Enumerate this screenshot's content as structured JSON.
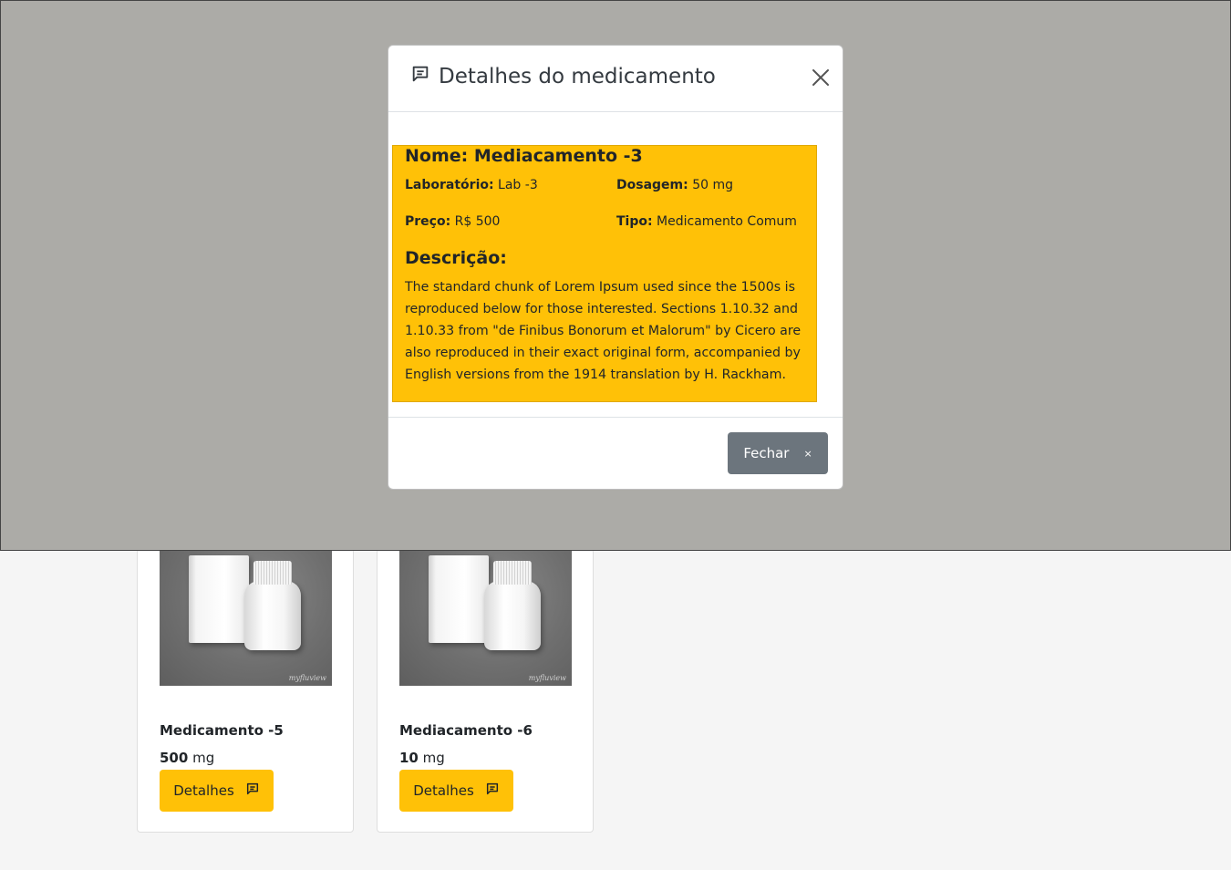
{
  "colors": {
    "warning": "#ffc107",
    "secondary": "#6c757d",
    "backdrop": "#acaba7"
  },
  "cards": [
    {
      "name": "Medicamento -5",
      "dose_value": "500",
      "dose_unit": "mg",
      "button_label": "Detalhes",
      "button_icon": "message-square-icon",
      "image_watermark": "myfluview"
    },
    {
      "name": "Mediacamento -6",
      "dose_value": "10",
      "dose_unit": "mg",
      "button_label": "Detalhes",
      "button_icon": "message-square-icon",
      "image_watermark": "myfluview"
    }
  ],
  "modal": {
    "title": "Detalhes do medicamento",
    "title_icon": "message-square-icon",
    "close_icon": "close-icon",
    "name_label": "Nome:",
    "name_value": "Mediacamento -3",
    "lab_label": "Laboratório:",
    "lab_value": "Lab -3",
    "dose_label": "Dosagem:",
    "dose_value": "50 mg",
    "price_label": "Preço:",
    "price_value": "R$ 500",
    "type_label": "Tipo:",
    "type_value": "Medicamento Comum",
    "desc_title": "Descrição:",
    "description": "The standard chunk of Lorem Ipsum used since the 1500s is reproduced below for those interested. Sections 1.10.32 and 1.10.33 from \"de Finibus Bonorum et Malorum\" by Cicero are also reproduced in their exact original form, accompanied by English versions from the 1914 translation by H. Rackham.",
    "close_button_label": "Fechar",
    "close_button_icon": "×"
  }
}
